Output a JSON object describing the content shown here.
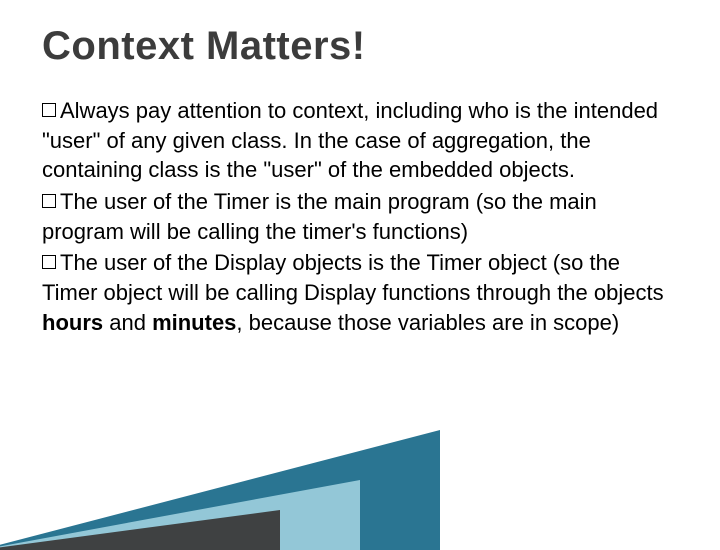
{
  "title": "Context Matters!",
  "bullets": [
    {
      "lead": "Always",
      "rest": " pay attention to context, including who is the intended \"user\" of any given class. In the case of aggregation, the containing class is the \"user\" of the embedded objects."
    },
    {
      "lead": "The",
      "rest_before": " user of the Timer is the main program (so the main program will be calling the timer's functions)"
    },
    {
      "lead": "The",
      "rest_before": " user of the Display objects is the Timer object (so the Timer object will be calling Display functions through the objects ",
      "bold1": "hours",
      "mid": " and ",
      "bold2": "minutes",
      "rest_after": ", because those variables are in scope)"
    }
  ]
}
